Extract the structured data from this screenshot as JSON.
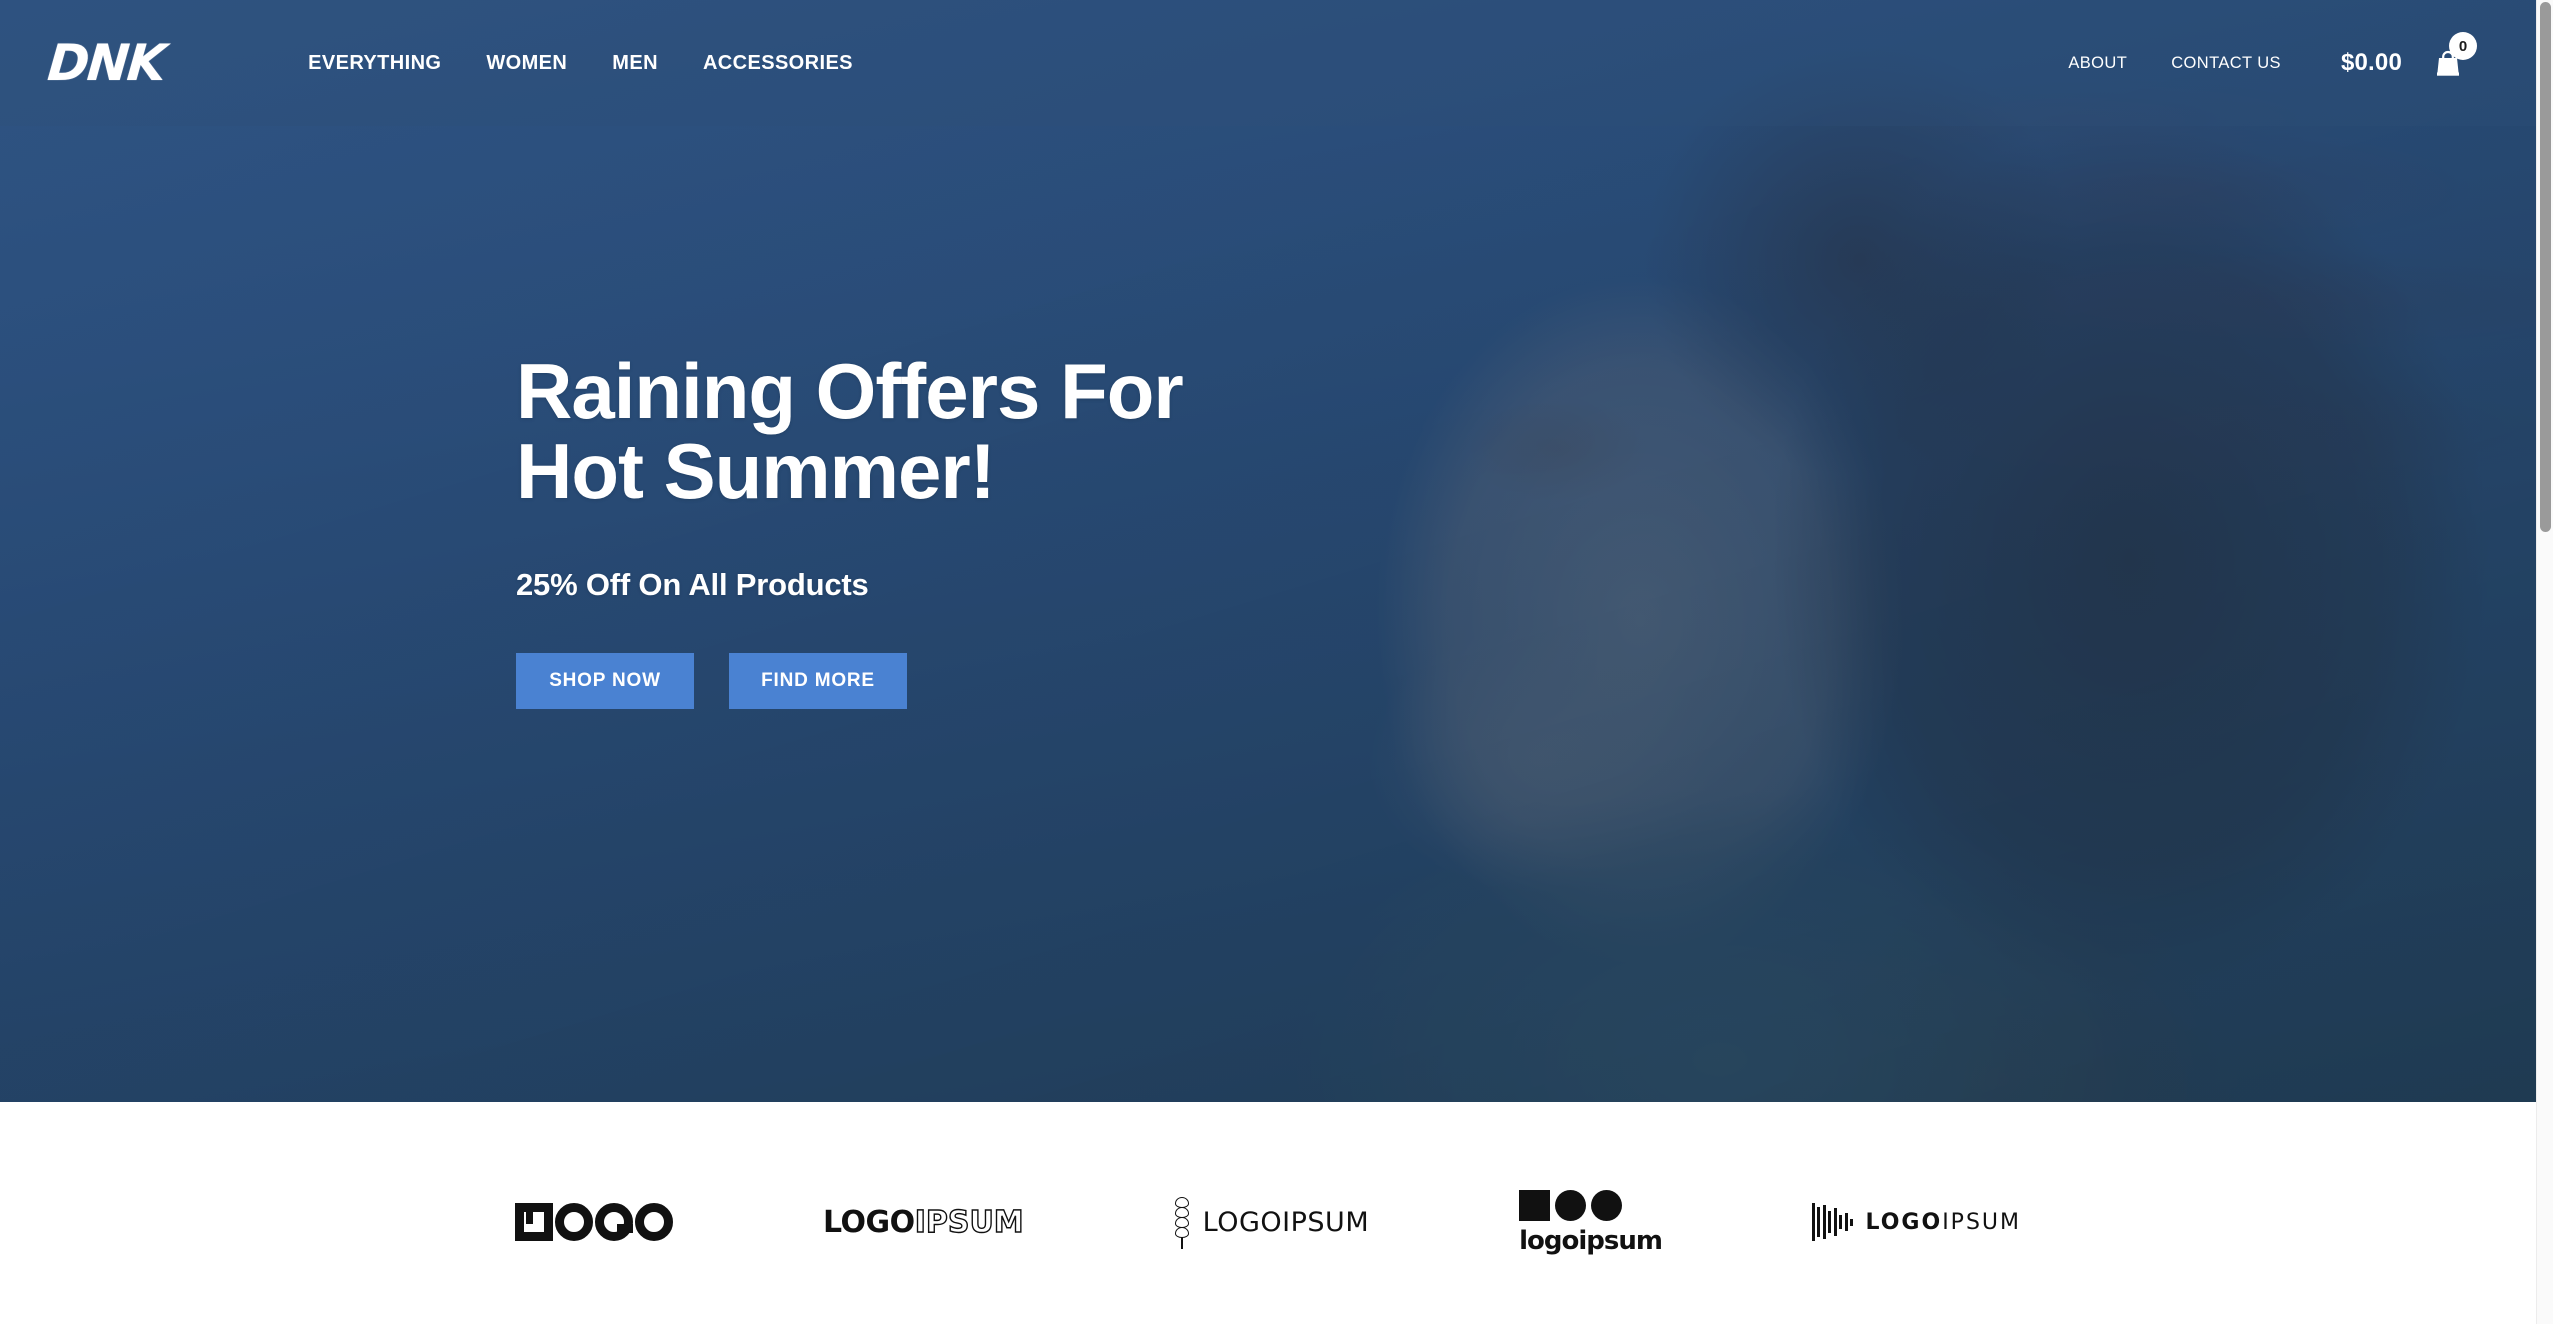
{
  "header": {
    "brand": "DNK",
    "nav_main": [
      {
        "label": "EVERYTHING"
      },
      {
        "label": "WOMEN"
      },
      {
        "label": "MEN"
      },
      {
        "label": "ACCESSORIES"
      }
    ],
    "nav_right": [
      {
        "label": "ABOUT"
      },
      {
        "label": "CONTACT US"
      }
    ],
    "cart": {
      "total": "$0.00",
      "count": "0",
      "icon": "shopping-bag-icon"
    },
    "background_color": "#3b6293"
  },
  "hero": {
    "title": "Raining Offers For\nHot Summer!",
    "subtitle": "25% Off On All Products",
    "buttons": [
      {
        "label": "SHOP NOW",
        "name": "shop-now-button"
      },
      {
        "label": "FIND MORE",
        "name": "find-more-button"
      }
    ],
    "button_color": "#4a82d2",
    "overlay_color_top": "#456b96",
    "overlay_color_bottom": "#34566b",
    "image_alt": "Woman in profile wearing sunglasses against a blue sky"
  },
  "partners": {
    "logos": [
      {
        "name": "logo-square-ogo",
        "text": "LOGO"
      },
      {
        "name": "logo-logoipsum-bold",
        "text_solid": "LOGO",
        "text_outline": "IPSUM"
      },
      {
        "name": "logo-logoipsum-wheat",
        "text": "LOGOIPSUM"
      },
      {
        "name": "logo-logoipsum-shapes",
        "text": "logoipsum",
        "dot": "•"
      },
      {
        "name": "logo-logoipsum-bars",
        "text_bold": "LOGO",
        "text_light": "IPSUM"
      }
    ]
  },
  "scrollbar": {
    "thumb_color": "#9a9a9a",
    "track_color": "#fafafa"
  }
}
